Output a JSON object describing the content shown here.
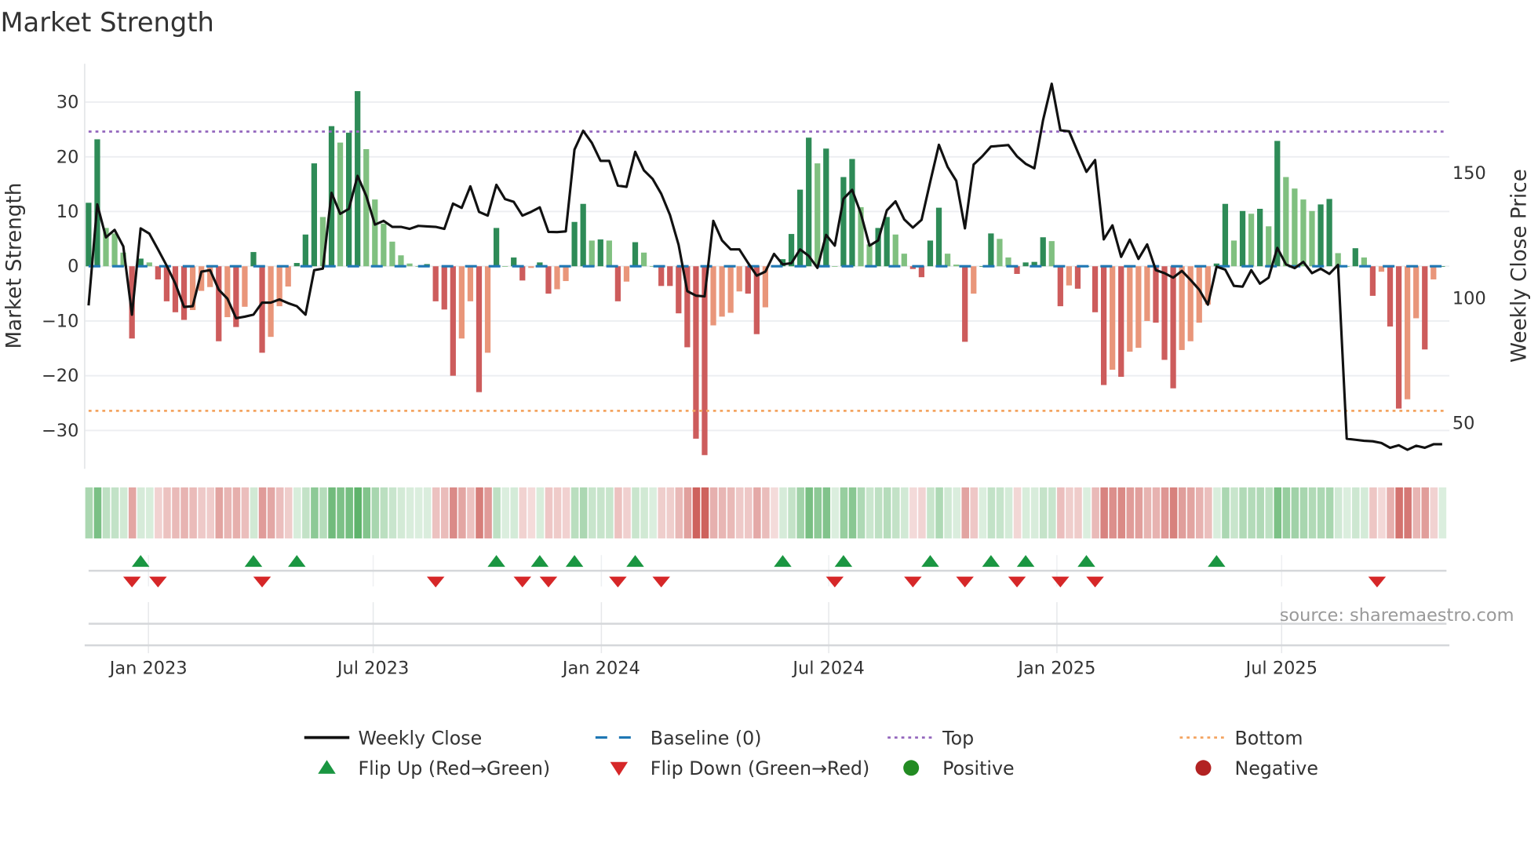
{
  "chart_data": {
    "type": "bar",
    "title": "Market Strength",
    "ylabel": "Market Strength",
    "y2label": "Weekly Close Price",
    "ylim": [
      -37,
      37
    ],
    "y2lim": [
      31.8,
      193.7
    ],
    "yticks": [
      "30",
      "20",
      "10",
      "0",
      "−10",
      "−20",
      "−30"
    ],
    "ytick_values": [
      30,
      20,
      10,
      0,
      -10,
      -20,
      -30
    ],
    "y2ticks": [
      "150",
      "100",
      "50"
    ],
    "y2tick_values": [
      150,
      100,
      50
    ],
    "x_ticks": [
      {
        "label": "Jan 2023",
        "week": 6.9
      },
      {
        "label": "Jul 2023",
        "week": 32.8
      },
      {
        "label": "Jan 2024",
        "week": 59.1
      },
      {
        "label": "Jul 2024",
        "week": 85.3
      },
      {
        "label": "Jan 2025",
        "week": 111.6
      },
      {
        "label": "Jul 2025",
        "week": 137.5
      }
    ],
    "top_level": 24.6,
    "bottom_level": -26.4,
    "baseline": 0,
    "strength": [
      11.6,
      23.2,
      7,
      6,
      2.5,
      -13.2,
      1.4,
      0.7,
      -2.4,
      -6.4,
      -8.4,
      -9.8,
      -8,
      -4.5,
      -3.8,
      -13.7,
      -9.3,
      -11.1,
      -7.4,
      2.6,
      -15.8,
      -12.9,
      -7.3,
      -3.7,
      0.6,
      5.8,
      18.8,
      9,
      25.6,
      22.6,
      24.4,
      32,
      21.4,
      12.2,
      7.8,
      4.5,
      2,
      0.5,
      0,
      0.4,
      -6.4,
      -7.9,
      -20,
      -13.2,
      -6.4,
      -23,
      -15.8,
      7,
      0,
      1.6,
      -2.6,
      -0.3,
      0.7,
      -5,
      -4.2,
      -2.7,
      8.1,
      11.4,
      4.7,
      4.9,
      4.7,
      -6.4,
      -2.8,
      4.4,
      2.5,
      0,
      -3.6,
      -3.6,
      -8.6,
      -14.8,
      -31.5,
      -34.5,
      -10.8,
      -9.2,
      -8.5,
      -4.6,
      -5,
      -12.4,
      -7.5,
      -0.2,
      1.3,
      5.9,
      14,
      23.5,
      18.8,
      21.5,
      0,
      16.3,
      19.6,
      10.8,
      4,
      7,
      9,
      5.8,
      2.3,
      -0.5,
      -2,
      4.7,
      10.7,
      2.3,
      0.3,
      -13.8,
      -5,
      0,
      6,
      5,
      1.6,
      -1.4,
      0.7,
      0.8,
      5.3,
      4.6,
      -7.3,
      -3.5,
      -4.1,
      0,
      -8.4,
      -21.7,
      -18.9,
      -20.2,
      -15.6,
      -14.9,
      -10,
      -10.3,
      -17.1,
      -22.3,
      -15.3,
      -13.7,
      -10.3,
      -7,
      0.5,
      11.4,
      4.7,
      10.1,
      9.6,
      10.5,
      7.3,
      22.9,
      16.3,
      14.2,
      12.2,
      10.1,
      11.3,
      12.3,
      2.4,
      0,
      3.3,
      1.6,
      -5.4,
      -1,
      -11,
      -26,
      -24.3,
      -9.5,
      -15.2,
      -2.4,
      0
    ],
    "weekly_close": [
      97.1,
      137.5,
      124.3,
      127.3,
      120.7,
      93.4,
      127.9,
      125.8,
      119.5,
      113,
      105.8,
      96.5,
      96.8,
      110.6,
      111.2,
      103.4,
      99.8,
      92,
      92.6,
      93.4,
      98.2,
      98.2,
      99.5,
      98,
      96.8,
      93.4,
      111.2,
      111.8,
      142.1,
      133.7,
      135.7,
      148.9,
      140.9,
      129.4,
      130.9,
      128.5,
      128.5,
      127.7,
      128.9,
      128.7,
      128.5,
      127.7,
      137.8,
      136.1,
      144.7,
      134.5,
      133,
      145.3,
      139.6,
      138.5,
      133,
      134.5,
      136.3,
      126.5,
      126.4,
      126.7,
      159.4,
      166.9,
      162.1,
      154.9,
      154.9,
      145,
      144.5,
      158.5,
      151.1,
      147.7,
      141.7,
      133.3,
      121.3,
      102.8,
      101,
      100.7,
      130.9,
      123.1,
      119.5,
      119.5,
      114.1,
      109,
      110.6,
      117.7,
      113.5,
      114,
      119.5,
      116.9,
      112.1,
      125.3,
      121,
      139.7,
      143.3,
      133.9,
      121,
      123.1,
      135.1,
      138.7,
      131.5,
      128.2,
      131.3,
      146.5,
      161.3,
      152.5,
      146.9,
      127.9,
      153.4,
      156.7,
      160.6,
      160.9,
      161.2,
      156.7,
      153.7,
      151.9,
      171.1,
      185.7,
      167.1,
      166.7,
      158.5,
      150.5,
      155.2,
      123.5,
      129.1,
      116.5,
      123.4,
      115.7,
      121.5,
      111.2,
      110,
      108.2,
      110.9,
      107.3,
      103.4,
      97.4,
      112.6,
      111.4,
      104.9,
      104.6,
      111.2,
      105.8,
      108.2,
      120.1,
      113.5,
      112,
      114.5,
      110,
      111.8,
      109.7,
      113.3,
      43.8,
      43.4,
      43,
      42.8,
      42.1,
      40.2,
      41.2,
      39.4,
      41,
      40.2,
      41.6,
      41.6
    ],
    "flip_up_weeks": [
      6,
      19,
      24,
      47,
      52,
      56,
      63,
      80,
      87,
      97,
      104,
      108,
      115,
      130
    ],
    "flip_down_weeks": [
      5,
      8,
      20,
      40,
      50,
      53,
      61,
      66,
      86,
      95,
      101,
      107,
      112,
      116,
      148.5
    ],
    "colors": {
      "strong_positive": "#2e8b57",
      "weak_positive": "#80c080",
      "strong_negative": "#cd5c5c",
      "weak_negative": "#e9967a",
      "line": "#111111",
      "baseline": "#1f77b4",
      "top": "#9467bd",
      "bottom": "#f4a460",
      "flip_up": "#1a9641",
      "flip_down": "#d62728",
      "positive": "#228b22",
      "negative": "#b22222"
    },
    "legend": {
      "weekly_close": "Weekly Close",
      "baseline": "Baseline (0)",
      "top": "Top",
      "bottom": "Bottom",
      "flip_up": "Flip Up (Red→Green)",
      "flip_down": "Flip Down (Green→Red)",
      "positive": "Positive",
      "negative": "Negative"
    },
    "legend_placement": "bottom-center",
    "source": "source: sharemaestro.com"
  }
}
